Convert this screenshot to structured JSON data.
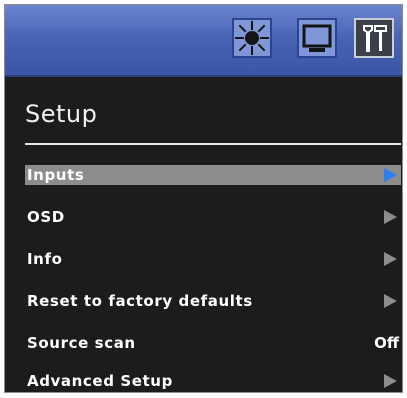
{
  "topbar": {
    "tabs": [
      {
        "icon": "brightness-icon",
        "active": false
      },
      {
        "icon": "display-icon",
        "active": false
      },
      {
        "icon": "tools-icon",
        "active": true
      }
    ]
  },
  "menu": {
    "title": "Setup",
    "selected_index": 0,
    "items": [
      {
        "label": "Inputs",
        "has_submenu": true
      },
      {
        "label": "OSD",
        "has_submenu": true
      },
      {
        "label": "Info",
        "has_submenu": true
      },
      {
        "label": "Reset to factory defaults",
        "has_submenu": true
      },
      {
        "label": "Source scan",
        "value": "Off"
      },
      {
        "label": "Advanced Setup",
        "has_submenu": true
      }
    ]
  },
  "colors": {
    "topbar": "#4a64b5",
    "panel_background": "#1c1c1c",
    "selected_row": "#8c8c8c",
    "selected_arrow": "#2f7bf0",
    "arrow": "#8d8d8d",
    "text": "#ffffff"
  }
}
